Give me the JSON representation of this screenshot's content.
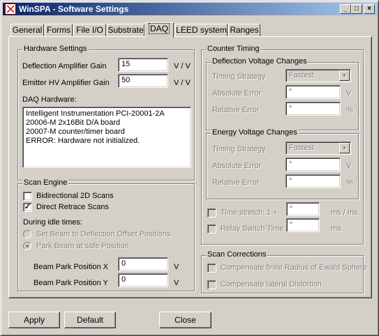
{
  "window": {
    "title": "WinSPA - Software Settings"
  },
  "title_buttons": {
    "minimize": "_",
    "maximize": "□",
    "close": "×"
  },
  "tabs": [
    {
      "label": "General"
    },
    {
      "label": "Forms"
    },
    {
      "label": "File I/O"
    },
    {
      "label": "Substrate"
    },
    {
      "label": "DAQ",
      "active": true
    },
    {
      "label": "LEED system"
    },
    {
      "label": "Ranges"
    }
  ],
  "hardware": {
    "legend": "Hardware Settings",
    "deflection_label": "Deflection Amplifier Gain",
    "deflection_value": "15",
    "deflection_unit": "V / V",
    "emitter_label": "Emitter HV Amplifier Gain",
    "emitter_value": "50",
    "emitter_unit": "V / V",
    "daq_label": "DAQ Hardware:",
    "daq_lines": [
      "Intelligent Instrumentation PCI-20001-2A",
      "20006-M 2x16Bit D/A board",
      "20007-M counter/timer board",
      "ERROR: Hardware not initialized."
    ]
  },
  "scan_engine": {
    "legend": "Scan Engine",
    "bidirectional_label": "Bidirectional 2D Scans",
    "bidirectional_checked": false,
    "direct_retrace_label": "Direct Retrace Scans",
    "direct_retrace_checked": true,
    "idle_label": "During idle times:",
    "radio_deflection_label": "Set Beam to Deflection Offset Positions",
    "radio_park_label": "Park Beam at safe Position",
    "park_x_label": "Beam Park Position X",
    "park_x_value": "0",
    "park_x_unit": "V",
    "park_y_label": "Beam Park Position Y",
    "park_y_value": "0",
    "park_y_unit": "V"
  },
  "counter_timing": {
    "legend": "Counter Timing",
    "deflection": {
      "legend": "Deflection Voltage Changes",
      "strategy_label": "Timing Strategy",
      "strategy_value": "Fastest",
      "abs_label": "Absolute Error",
      "abs_value": "*",
      "abs_unit": "V",
      "rel_label": "Relative Error",
      "rel_value": "*",
      "rel_unit": "%"
    },
    "energy": {
      "legend": "Energy Voltage Changes",
      "strategy_label": "Timing Strategy",
      "strategy_value": "Fastest",
      "abs_label": "Absolute Error",
      "abs_value": "*",
      "abs_unit": "V",
      "rel_label": "Relative Error",
      "rel_value": "*",
      "rel_unit": "%"
    },
    "time_stretch_label": "Time stretch:  1 +",
    "time_stretch_value": "*",
    "time_stretch_unit": "ms / ms",
    "relay_label": "Relay Switch Time",
    "relay_value": "*",
    "relay_unit": "ms"
  },
  "scan_corrections": {
    "legend": "Scan Corrections",
    "ewald_label": "Compensate finite Radius of Ewald Sphere",
    "lateral_label": "Compensate lateral Distortion"
  },
  "buttons": {
    "apply": "Apply",
    "default": "Default",
    "close": "Close"
  }
}
